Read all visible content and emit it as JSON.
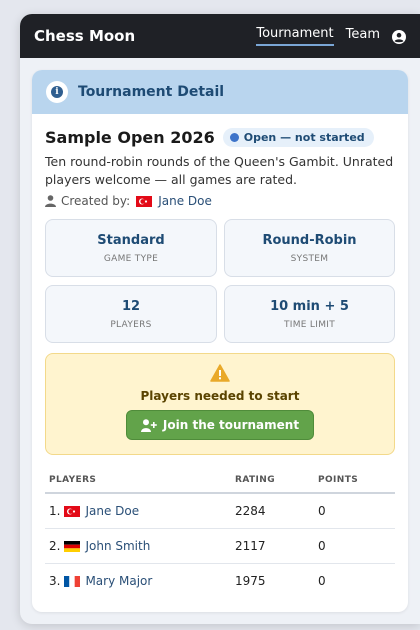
{
  "navbar": {
    "brand": "Chess Moon",
    "links": [
      {
        "label": "Tournament",
        "active": true
      },
      {
        "label": "Team",
        "active": false
      }
    ],
    "user_icon": "user-circle-icon"
  },
  "card": {
    "header": "Tournament Detail",
    "title": "Sample Open 2026",
    "status": "Open — not started",
    "description": "Ten round-robin rounds of the Queen's Gambit. Unrated players welcome — all games are rated.",
    "creator_label": "Created by:",
    "creator_name": "Jane Doe",
    "stats": [
      {
        "value": "Standard",
        "label": "GAME TYPE"
      },
      {
        "value": "Round-Robin",
        "label": "SYSTEM"
      },
      {
        "value": "12",
        "label": "PLAYERS"
      },
      {
        "value": "10 min + 5",
        "label": "TIME LIMIT"
      }
    ],
    "alert": {
      "text": "Players needed to start",
      "button": "Join the tournament"
    },
    "table": {
      "headers": [
        "PLAYERS",
        "RATING",
        "POINTS"
      ],
      "rows": [
        {
          "rank": "1.",
          "flag": "turkey",
          "name": "Jane Doe",
          "rating": "2284",
          "points": "0"
        },
        {
          "rank": "2.",
          "flag": "germany",
          "name": "John Smith",
          "rating": "2117",
          "points": "0"
        },
        {
          "rank": "3.",
          "flag": "france",
          "name": "Mary Major",
          "rating": "1975",
          "points": "0"
        }
      ]
    }
  },
  "colors": {
    "navbar": "#1f2126",
    "header": "#b9d5ee",
    "accent": "#1e4b74",
    "alert_bg": "#fff4cf",
    "button": "#62a34a"
  }
}
